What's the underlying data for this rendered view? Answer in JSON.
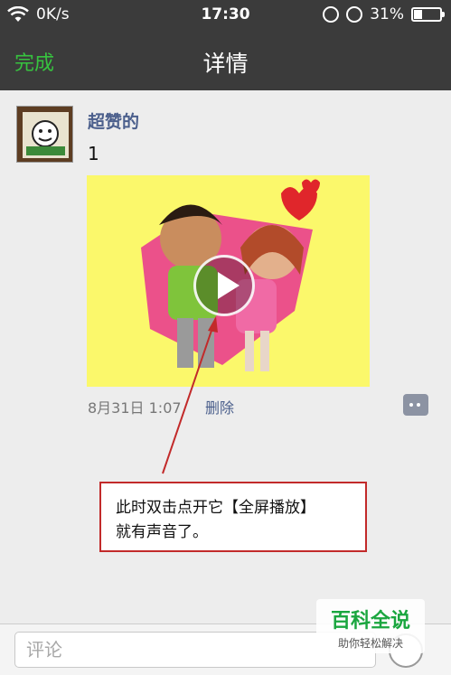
{
  "status_bar": {
    "network_speed": "0K/s",
    "time": "17:30",
    "battery_percent": "31%",
    "battery_level": 0.31
  },
  "nav": {
    "done_label": "完成",
    "title": "详情"
  },
  "post": {
    "username": "超赞的",
    "text": "1",
    "date": "8月31日 1:07",
    "delete_label": "删除"
  },
  "annotation": {
    "line1": "此时双击点开它【全屏播放】",
    "line2": "就有声音了。"
  },
  "comment_box": {
    "placeholder": "评论"
  },
  "watermark": {
    "title": "百科全说",
    "subtitle": "助你轻松解决"
  },
  "colors": {
    "nav_bg": "#3b3b3b",
    "accent_green": "#37c33f",
    "link_blue": "#4b5f8c",
    "annotation_red": "#c22a2a"
  }
}
